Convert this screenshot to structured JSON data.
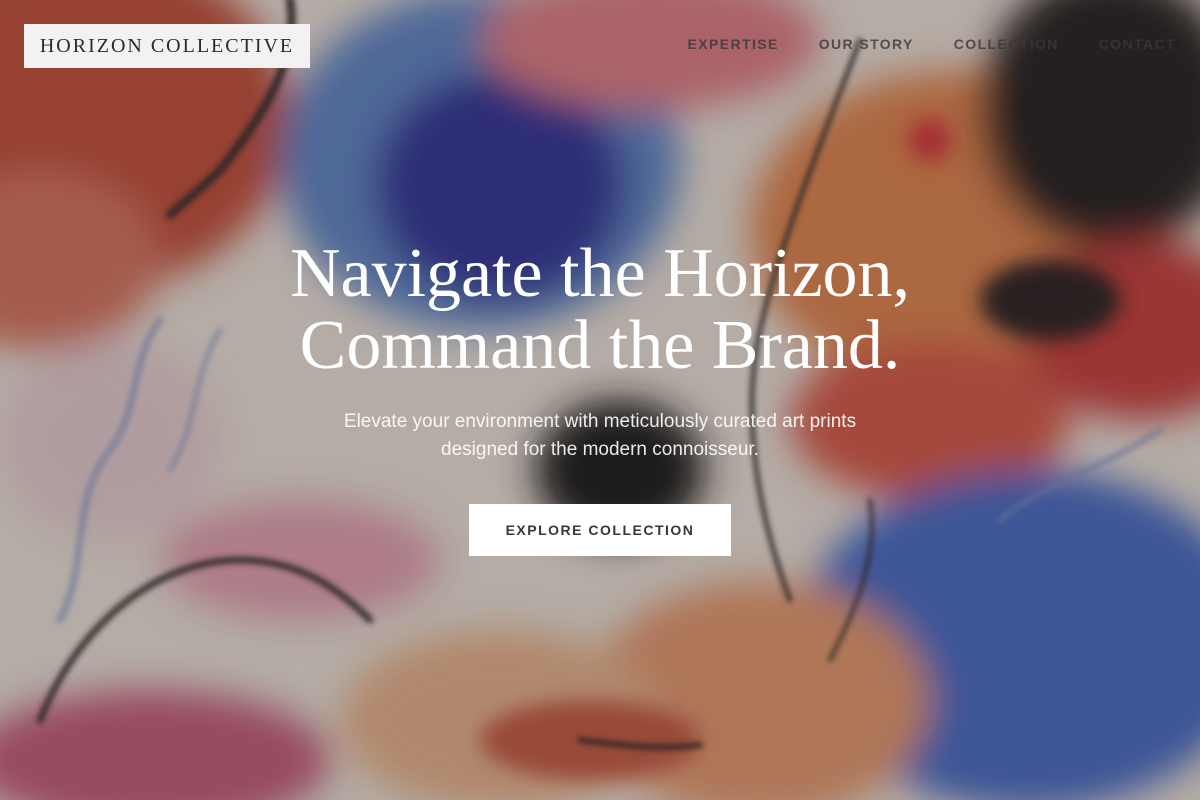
{
  "brand": {
    "name": "HORIZON COLLECTIVE"
  },
  "nav": {
    "items": [
      {
        "label": "EXPERTISE"
      },
      {
        "label": "OUR STORY"
      },
      {
        "label": "COLLECTION"
      },
      {
        "label": "CONTACT"
      }
    ]
  },
  "hero": {
    "headline_line1": "Navigate the Horizon,",
    "headline_line2": "Command the Brand.",
    "subtext_line1": "Elevate your environment with meticulously curated art prints",
    "subtext_line2": "designed for the modern connoisseur.",
    "cta_label": "EXPLORE COLLECTION"
  },
  "colors": {
    "overlay": "#231c1e",
    "logo_bg": "#f3f1f1",
    "cta_bg": "#ffffff",
    "text_light": "#ffffff",
    "text_dark": "#3a3636"
  }
}
